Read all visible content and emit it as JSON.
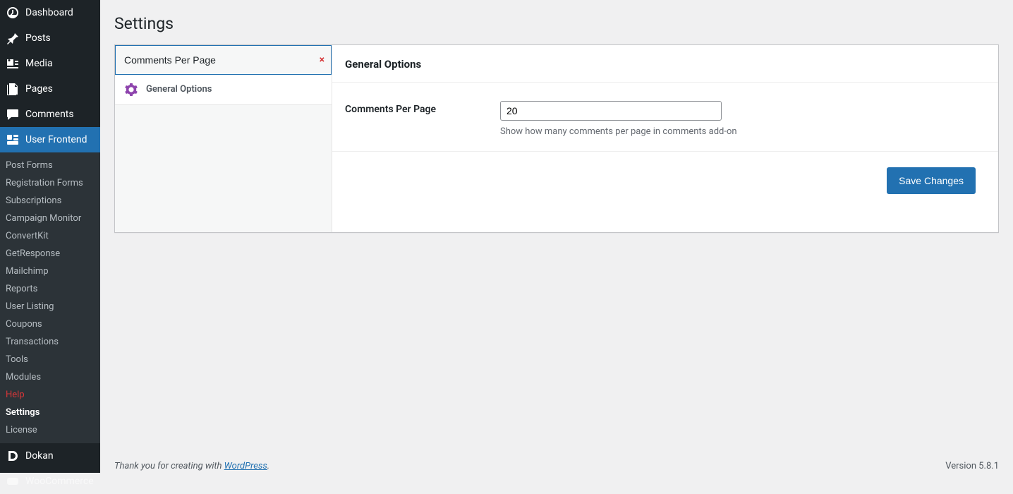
{
  "sidebar": {
    "items": [
      {
        "label": "Dashboard",
        "icon": "dashboard"
      },
      {
        "label": "Posts",
        "icon": "pin"
      },
      {
        "label": "Media",
        "icon": "media"
      },
      {
        "label": "Pages",
        "icon": "pages"
      },
      {
        "label": "Comments",
        "icon": "comment"
      },
      {
        "label": "User Frontend",
        "icon": "uf"
      },
      {
        "label": "Dokan",
        "icon": "dokan"
      },
      {
        "label": "WooCommerce",
        "icon": "woo"
      }
    ],
    "submenu": [
      "Post Forms",
      "Registration Forms",
      "Subscriptions",
      "Campaign Monitor",
      "ConvertKit",
      "GetResponse",
      "Mailchimp",
      "Reports",
      "User Listing",
      "Coupons",
      "Transactions",
      "Tools",
      "Modules",
      "Help",
      "Settings",
      "License"
    ]
  },
  "page": {
    "title": "Settings"
  },
  "search": {
    "value": "Comments Per Page",
    "clear": "×"
  },
  "tabs": [
    {
      "label": "General Options"
    }
  ],
  "section": {
    "heading": "General Options",
    "field_label": "Comments Per Page",
    "field_value": "20",
    "field_desc": "Show how many comments per page in comments add-on",
    "save": "Save Changes"
  },
  "footer": {
    "thanks": "Thank you for creating with ",
    "link": "WordPress",
    "dot": ".",
    "version": "Version 5.8.1"
  }
}
